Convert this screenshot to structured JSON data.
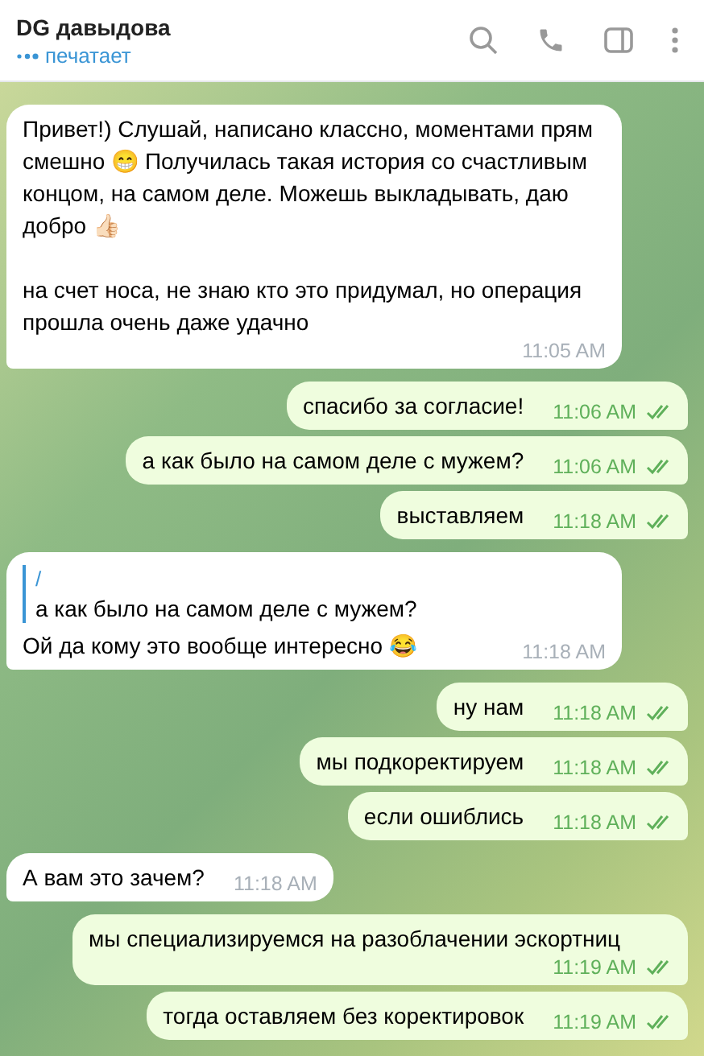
{
  "header": {
    "title": "DG давыдова",
    "status": "печатает"
  },
  "messages": [
    {
      "kind": "incoming",
      "text": "Привет!) Слушай, написано классно, моментами прям смешно 😁 Получилась такая история со счастливым концом, на самом деле. Можешь выкладывать, даю добро 👍🏻\n\nна счет носа, не знаю кто это придумал, но операция прошла очень даже удачно",
      "time": "11:05 AM"
    },
    {
      "kind": "outgoing",
      "text": "спасибо за согласие!",
      "time": "11:06 AM",
      "read": true
    },
    {
      "kind": "outgoing",
      "text": "а как было на самом деле с мужем?",
      "time": "11:06 AM",
      "read": true
    },
    {
      "kind": "outgoing",
      "text": "выставляем",
      "time": "11:18 AM",
      "read": true
    },
    {
      "kind": "incoming",
      "reply": {
        "author": "/",
        "text": "а как было на самом деле с мужем?"
      },
      "text": "Ой да кому это вообще интересно 😂",
      "time": "11:18 AM"
    },
    {
      "kind": "outgoing",
      "text": "ну нам",
      "time": "11:18 AM",
      "read": true
    },
    {
      "kind": "outgoing",
      "text": "мы подкоректируем",
      "time": "11:18 AM",
      "read": true
    },
    {
      "kind": "outgoing",
      "text": "если ошиблись",
      "time": "11:18 AM",
      "read": true
    },
    {
      "kind": "incoming",
      "text": "А вам это зачем?",
      "time": "11:18 AM"
    },
    {
      "kind": "outgoing",
      "text": "мы специализируемся на разоблачении эскортниц",
      "time": "11:19 AM",
      "read": true
    },
    {
      "kind": "outgoing",
      "text": "тогда оставляем без коректировок",
      "time": "11:19 AM",
      "read": true
    }
  ]
}
